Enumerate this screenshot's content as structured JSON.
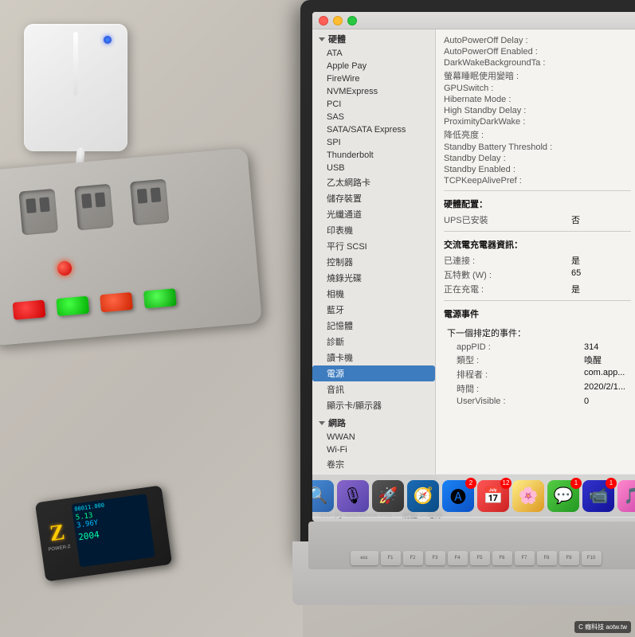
{
  "photo": {
    "description": "MacBook Pro with System Information open showing Power settings, connected to power strip with USB charger"
  },
  "sidebar": {
    "section_label": "硬體",
    "items": [
      {
        "id": "ata",
        "label": "ATA",
        "selected": false
      },
      {
        "id": "apple-pay",
        "label": "Apple Pay",
        "selected": false
      },
      {
        "id": "firewire",
        "label": "FireWire",
        "selected": false
      },
      {
        "id": "nvmexpress",
        "label": "NVMExpress",
        "selected": false
      },
      {
        "id": "pci",
        "label": "PCI",
        "selected": false
      },
      {
        "id": "sas",
        "label": "SAS",
        "selected": false
      },
      {
        "id": "sata",
        "label": "SATA/SATA Express",
        "selected": false
      },
      {
        "id": "spi",
        "label": "SPI",
        "selected": false
      },
      {
        "id": "thunderbolt",
        "label": "Thunderbolt",
        "selected": false
      },
      {
        "id": "usb",
        "label": "USB",
        "selected": false
      },
      {
        "id": "ethernet",
        "label": "乙太網路卡",
        "selected": false
      },
      {
        "id": "storage",
        "label": "儲存裝置",
        "selected": false
      },
      {
        "id": "fiber",
        "label": "光纖通道",
        "selected": false
      },
      {
        "id": "printer",
        "label": "印表機",
        "selected": false
      },
      {
        "id": "parallel-scsi",
        "label": "平行 SCSI",
        "selected": false
      },
      {
        "id": "controller",
        "label": "控制器",
        "selected": false
      },
      {
        "id": "bluetooth-mouse",
        "label": "燒錄光碟",
        "selected": false
      },
      {
        "id": "camera",
        "label": "相機",
        "selected": false
      },
      {
        "id": "bluetooth",
        "label": "藍牙",
        "selected": false
      },
      {
        "id": "memory",
        "label": "記憶體",
        "selected": false
      },
      {
        "id": "diagnostics",
        "label": "診斷",
        "selected": false
      },
      {
        "id": "card-reader",
        "label": "讀卡機",
        "selected": false
      },
      {
        "id": "power",
        "label": "電源",
        "selected": true
      },
      {
        "id": "audio",
        "label": "音訊",
        "selected": false
      },
      {
        "id": "display",
        "label": "顯示卡/顯示器",
        "selected": false
      }
    ],
    "network_section": "網路",
    "network_items": [
      {
        "id": "wwan",
        "label": "WWAN"
      },
      {
        "id": "wifi",
        "label": "Wi-Fi"
      },
      {
        "id": "volume",
        "label": "卷宗"
      }
    ]
  },
  "content": {
    "keys": [
      {
        "key": "AutoPowerOff Delay :",
        "val": ""
      },
      {
        "key": "AutoPowerOff Enabled :",
        "val": ""
      },
      {
        "key": "DarkWakeBackgroundTa :",
        "val": ""
      },
      {
        "key": "螢幕睡眠使用變暗 :",
        "val": ""
      },
      {
        "key": "GPUSwitch :",
        "val": ""
      },
      {
        "key": "Hibernate Mode :",
        "val": ""
      },
      {
        "key": "High Standby Delay :",
        "val": ""
      },
      {
        "key": "ProximityDarkWake :",
        "val": ""
      },
      {
        "key": "降低亮度 :",
        "val": ""
      },
      {
        "key": "Standby Battery Threshold :",
        "val": ""
      },
      {
        "key": "Standby Delay :",
        "val": ""
      },
      {
        "key": "Standby Enabled :",
        "val": ""
      },
      {
        "key": "TCPKeepAlivePref :",
        "val": ""
      }
    ],
    "hardware_config_title": "硬體配置：",
    "ups_installed_key": "UPS已安裝",
    "ups_installed_val": "否",
    "ac_charger_title": "交流電充電器資訊：",
    "ac_charger_keys": [
      {
        "key": "已連接 :",
        "val": "是"
      },
      {
        "key": "瓦特數 (W) :",
        "val": "65"
      },
      {
        "key": "正在充電 :",
        "val": "是"
      }
    ],
    "power_event_title": "電源事件",
    "next_event_title": "下一個排定的事件：",
    "next_event_keys": [
      {
        "key": "appPID :",
        "val": "314"
      },
      {
        "key": "類型 :",
        "val": "喚醒"
      },
      {
        "key": "排程者 :",
        "val": "com.app..."
      },
      {
        "key": "時間 :",
        "val": "2020/2/1..."
      },
      {
        "key": "UserVisible :",
        "val": "0"
      }
    ]
  },
  "breadcrumb": {
    "text": "Em 的 MacBook Pro > 硬體 > 電源"
  },
  "dock": {
    "icons": [
      {
        "id": "finder",
        "emoji": "🔍",
        "color": "#4a90d9",
        "badge": null
      },
      {
        "id": "siri",
        "emoji": "🎙",
        "color": "#6e5bb0",
        "badge": null
      },
      {
        "id": "launchpad",
        "emoji": "🚀",
        "color": "#555",
        "badge": null
      },
      {
        "id": "safari",
        "emoji": "🧭",
        "color": "#1a6bb5",
        "badge": null
      },
      {
        "id": "appstore",
        "emoji": "🅐",
        "color": "#1b82f5",
        "badge": "2",
        "badgeColor": "#ff3b30"
      },
      {
        "id": "calendar",
        "emoji": "📅",
        "color": "#f55",
        "badge": "12"
      },
      {
        "id": "photos",
        "emoji": "🌸",
        "color": "#ff9",
        "badge": null
      },
      {
        "id": "messages",
        "emoji": "💬",
        "color": "#55cc44",
        "badge": "1"
      },
      {
        "id": "facetime",
        "emoji": "📹",
        "color": "#33c",
        "badge": "1"
      },
      {
        "id": "itunes",
        "emoji": "🎵",
        "color": "#fc5",
        "badge": null
      }
    ]
  },
  "watermark": {
    "text": "C 癮科技 aotw.tw"
  },
  "power_meter": {
    "lines": [
      "00011.000",
      "5.13",
      "3.96Y",
      "2004"
    ],
    "logo": "Z",
    "brand": "POWER-Z"
  }
}
